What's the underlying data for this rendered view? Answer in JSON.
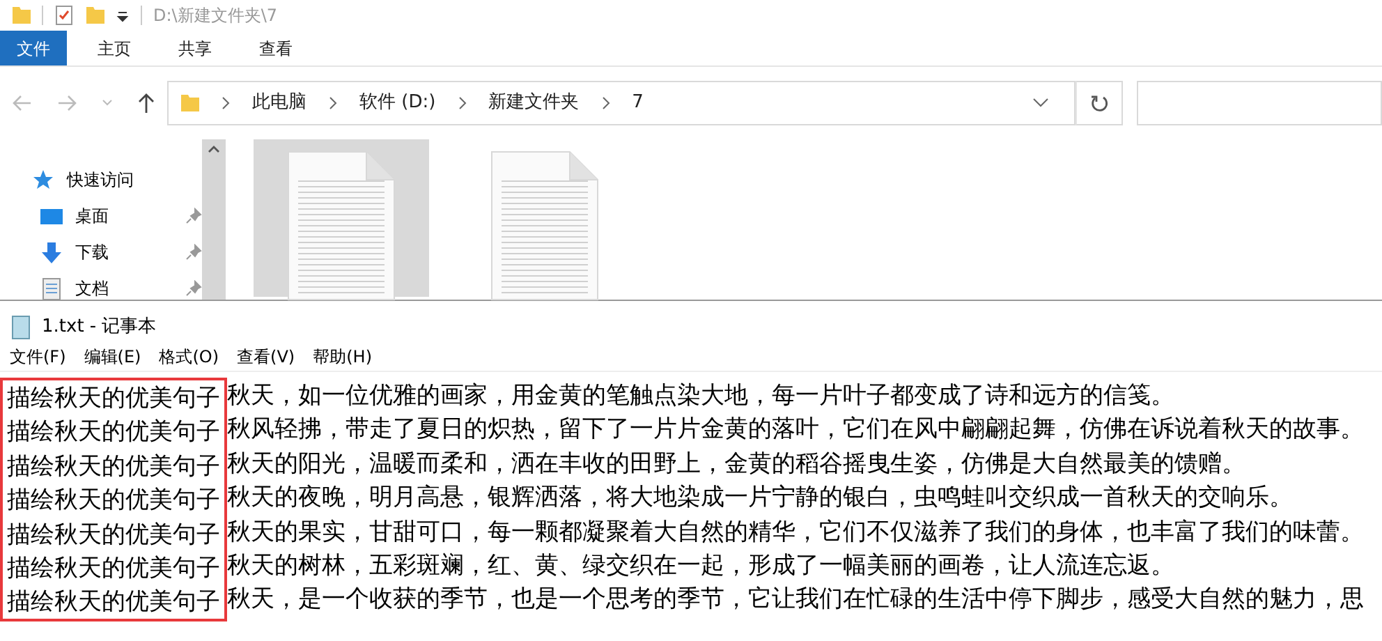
{
  "explorer": {
    "title_path": "D:\\新建文件夹\\7",
    "ribbon_tabs": [
      {
        "label": "文件",
        "selected": true
      },
      {
        "label": "主页",
        "selected": false
      },
      {
        "label": "共享",
        "selected": false
      },
      {
        "label": "查看",
        "selected": false
      }
    ],
    "breadcrumb": [
      "此电脑",
      "软件 (D:)",
      "新建文件夹",
      "7"
    ],
    "nav_items": [
      {
        "label": "快速访问",
        "kind": "star",
        "pinned": false
      },
      {
        "label": "桌面",
        "kind": "desktop",
        "pinned": true
      },
      {
        "label": "下载",
        "kind": "download",
        "pinned": true
      },
      {
        "label": "文档",
        "kind": "document",
        "pinned": true
      }
    ],
    "files": [
      {
        "selected": true
      },
      {
        "selected": false
      }
    ]
  },
  "notepad": {
    "title": "1.txt - 记事本",
    "menu": [
      "文件(F)",
      "编辑(E)",
      "格式(O)",
      "查看(V)",
      "帮助(H)"
    ],
    "highlight_prefix": true,
    "lines": [
      {
        "prefix": "描绘秋天的优美句子",
        "text": "秋天，如一位优雅的画家，用金黄的笔触点染大地，每一片叶子都变成了诗和远方的信笺。"
      },
      {
        "prefix": "描绘秋天的优美句子",
        "text": "秋风轻拂，带走了夏日的炽热，留下了一片片金黄的落叶，它们在风中翩翩起舞，仿佛在诉说着秋天的故事。"
      },
      {
        "prefix": "描绘秋天的优美句子",
        "text": "秋天的阳光，温暖而柔和，洒在丰收的田野上，金黄的稻谷摇曳生姿，仿佛是大自然最美的馈赠。"
      },
      {
        "prefix": "描绘秋天的优美句子",
        "text": "秋天的夜晚，明月高悬，银辉洒落，将大地染成一片宁静的银白，虫鸣蛙叫交织成一首秋天的交响乐。"
      },
      {
        "prefix": "描绘秋天的优美句子",
        "text": "秋天的果实，甘甜可口，每一颗都凝聚着大自然的精华，它们不仅滋养了我们的身体，也丰富了我们的味蕾。"
      },
      {
        "prefix": "描绘秋天的优美句子",
        "text": "秋天的树林，五彩斑斓，红、黄、绿交织在一起，形成了一幅美丽的画卷，让人流连忘返。"
      },
      {
        "prefix": "描绘秋天的优美句子",
        "text": "秋天，是一个收获的季节，也是一个思考的季节，它让我们在忙碌的生活中停下脚步，感受大自然的魅力，思"
      }
    ]
  }
}
